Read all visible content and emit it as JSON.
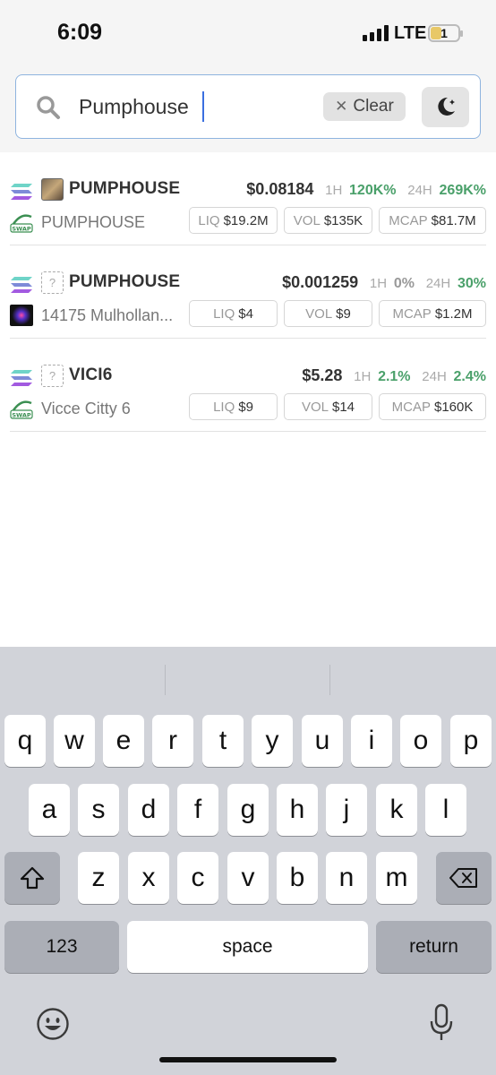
{
  "status": {
    "time": "6:09",
    "network": "LTE",
    "battery": "1"
  },
  "search": {
    "value": "Pumphouse",
    "clear_label": "Clear"
  },
  "results": [
    {
      "symbol": "PUMPHOUSE",
      "name": "PUMPHOUSE",
      "price": "$0.08184",
      "h1_label": "1H",
      "h1": "120K%",
      "h24_label": "24H",
      "h24": "269K%",
      "liq_label": "LIQ",
      "liq": "$19.2M",
      "vol_label": "VOL",
      "vol": "$135K",
      "mcap_label": "MCAP",
      "mcap": "$81.7M"
    },
    {
      "symbol": "PUMPHOUSE",
      "name": "14175 Mulhollan...",
      "price": "$0.001259",
      "h1_label": "1H",
      "h1": "0%",
      "h24_label": "24H",
      "h24": "30%",
      "liq_label": "LIQ",
      "liq": "$4",
      "vol_label": "VOL",
      "vol": "$9",
      "mcap_label": "MCAP",
      "mcap": "$1.2M"
    },
    {
      "symbol": "VICI6",
      "name": "Vicce Citty 6",
      "price": "$5.28",
      "h1_label": "1H",
      "h1": "2.1%",
      "h24_label": "24H",
      "h24": "2.4%",
      "liq_label": "LIQ",
      "liq": "$9",
      "vol_label": "VOL",
      "vol": "$14",
      "mcap_label": "MCAP",
      "mcap": "$160K"
    }
  ],
  "icons": {
    "unknown_token": "?",
    "dex_badge": "SWAP"
  },
  "keyboard": {
    "row1": [
      "q",
      "w",
      "e",
      "r",
      "t",
      "y",
      "u",
      "i",
      "o",
      "p"
    ],
    "row2": [
      "a",
      "s",
      "d",
      "f",
      "g",
      "h",
      "j",
      "k",
      "l"
    ],
    "row3": [
      "z",
      "x",
      "c",
      "v",
      "b",
      "n",
      "m"
    ],
    "numbers": "123",
    "space": "space",
    "return": "return"
  },
  "colors": {
    "positive": "#4aa06a",
    "neutral": "#999999",
    "accent": "#3a6fe0"
  }
}
